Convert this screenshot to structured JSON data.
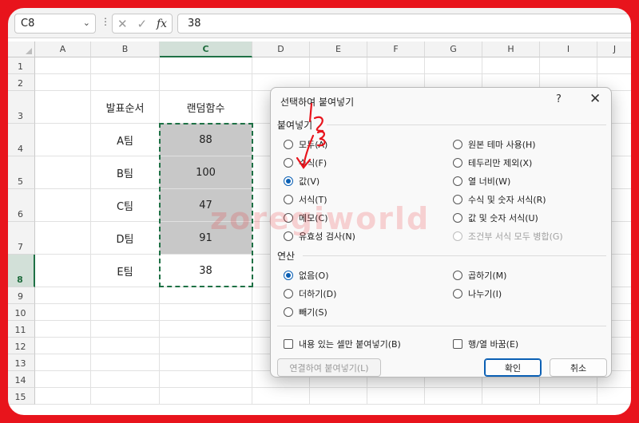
{
  "formula_bar": {
    "name_box": "C8",
    "dots": "⋮",
    "cancel_glyph": "✕",
    "confirm_glyph": "✓",
    "fx_label": "fx",
    "value": "38"
  },
  "columns": [
    "A",
    "B",
    "C",
    "D",
    "E",
    "F",
    "G",
    "H",
    "I",
    "J"
  ],
  "rows": [
    "1",
    "2",
    "3",
    "4",
    "5",
    "6",
    "7",
    "8",
    "9",
    "10",
    "11",
    "12",
    "13",
    "14",
    "15"
  ],
  "table": {
    "header_b": "발표순서",
    "header_c": "랜덤함수",
    "teams": [
      "A팀",
      "B팀",
      "C팀",
      "D팀",
      "E팀"
    ],
    "values": [
      "88",
      "100",
      "47",
      "91",
      "38"
    ]
  },
  "dialog": {
    "title": "선택하여 붙여넣기",
    "help": "?",
    "close": "✕",
    "paste_section": "붙여넣기",
    "paste_left": [
      "모두(A)",
      "수식(F)",
      "값(V)",
      "서식(T)",
      "메모(C)",
      "유효성 검사(N)"
    ],
    "paste_right": [
      "원본 테마 사용(H)",
      "테두리만 제외(X)",
      "열 너비(W)",
      "수식 및 숫자 서식(R)",
      "값 및 숫자 서식(U)",
      "조건부 서식 모두 병합(G)"
    ],
    "operation_section": "연산",
    "op_left": [
      "없음(O)",
      "더하기(D)",
      "빼기(S)"
    ],
    "op_right": [
      "곱하기(M)",
      "나누기(I)"
    ],
    "skip_blanks": "내용 있는 셀만 붙여넣기(B)",
    "transpose": "행/열 바꿈(E)",
    "paste_link": "연결하여 붙여넣기(L)",
    "ok": "확인",
    "cancel": "취소"
  },
  "watermark": "zoregiworld",
  "colors": {
    "accent": "#1e7145",
    "frame": "#e8141c",
    "radio": "#0a5fb4"
  }
}
